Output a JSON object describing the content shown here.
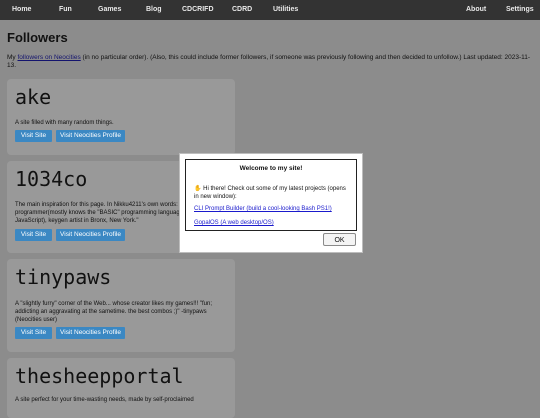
{
  "nav": {
    "home": "Home",
    "fun": "Fun",
    "games": "Games",
    "blog": "Blog",
    "cdcrifd": "CDCRIFD",
    "cdrd": "CDRD",
    "utilities": "Utilities",
    "about": "About",
    "settings": "Settings"
  },
  "page": {
    "title": "Followers",
    "intro_prefix": "My ",
    "intro_link": "followers on Neocities",
    "intro_suffix": " (in no particular order). (Also, this could include former followers, if someone was previously following and then decided to unfollow.) Last updated: 2023-11-13."
  },
  "followers": [
    {
      "name": "ake",
      "description": "A site filled with many random things.",
      "visit_label": "Visit Site",
      "profile_label": "Visit Neocities Profile"
    },
    {
      "name": "1034co",
      "description": "The main inspiration for this page. In Nikku4211's own words: \"Neocities, artist, programmer(mostly knows the \"BASIC\" programming language, C, Python, and JavaScript), keygen artist in Bronx, New York.\"",
      "visit_label": "Visit Site",
      "profile_label": "Visit Neocities Profile"
    },
    {
      "name": "tinypaws",
      "description": "A \"slightly furry\" corner of the Web... whose creator likes my games!!! \"fun; addicting an aggravating at the sametime. the best combos ;)\" -tinypaws (Neocities user)",
      "visit_label": "Visit Site",
      "profile_label": "Visit Neocities Profile"
    },
    {
      "name": "thesheepportal",
      "description": "A site perfect for your time-wasting needs, made by self-proclaimed"
    }
  ],
  "dialog": {
    "title": "Welcome to my site!",
    "message": "Hi there! Check out some of my latest projects (opens in new window):",
    "wave_icon": "waving-hand-icon",
    "links": [
      "CLI Prompt Builder (build a cool-looking Bash PS1!)",
      "GopalOS (A web desktop/OS)"
    ],
    "ok_label": "OK"
  },
  "colors": {
    "navbar": "#333333",
    "overlay_background": "#8c8c8c",
    "card": "#999999",
    "button": "#3b88c3",
    "link": "#1a1acc"
  }
}
